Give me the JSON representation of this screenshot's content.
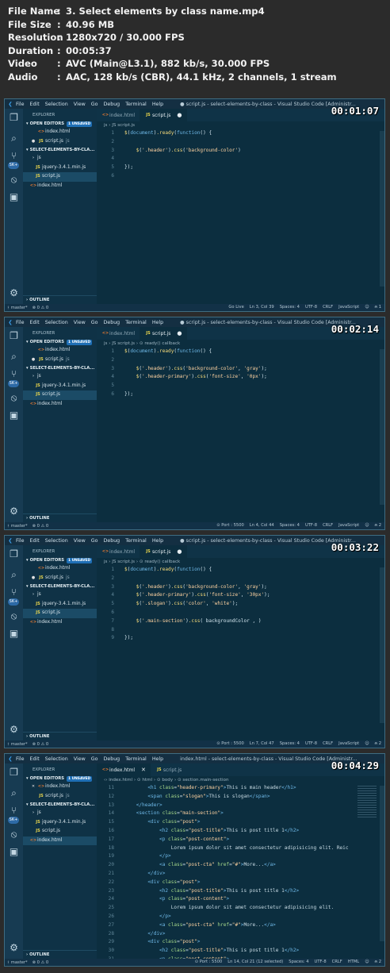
{
  "meta": {
    "rows": [
      {
        "key": "File Name",
        "value": "3. Select elements by class name.mp4"
      },
      {
        "key": "File Size",
        "value": "40.96 MB"
      },
      {
        "key": "Resolution",
        "value": "1280x720 / 30.000 FPS"
      },
      {
        "key": "Duration",
        "value": "00:05:37"
      },
      {
        "key": "Video",
        "value": "AVC (Main@L3.1), 882 kb/s, 30.000 FPS"
      },
      {
        "key": "Audio",
        "value": "AAC, 128 kb/s (CBR), 44.1 kHz, 2 channels, 1 stream"
      }
    ]
  },
  "menu": [
    "File",
    "Edit",
    "Selection",
    "View",
    "Go",
    "Debug",
    "Terminal",
    "Help"
  ],
  "explorer": {
    "title": "EXPLORER",
    "open_editors": "OPEN EDITORS",
    "unsaved": "1 UNSAVED",
    "folder": "SELECT-ELEMENTS-BY-CLA...",
    "outline": "OUTLINE",
    "files": {
      "js_folder": "js",
      "jquery": "jquery-3.4.1.min.js",
      "script": "script.js",
      "index": "index.html"
    }
  },
  "frames": [
    {
      "timestamp": "00:01:07",
      "window_title": "● script.js - select-elements-by-class - Visual Studio Code [Administr...",
      "open_files": [
        {
          "icon": "html",
          "name": "index.html",
          "extra": ""
        },
        {
          "icon": "js",
          "name": "script.js",
          "extra": "js",
          "dot": true
        }
      ],
      "tabs": [
        {
          "label": "index.html",
          "active": false,
          "icon": "html",
          "mark": ""
        },
        {
          "label": "script.js",
          "active": true,
          "icon": "js",
          "mark": "●"
        }
      ],
      "crumbs": "js › JS script.js",
      "code": [
        {
          "n": "1",
          "t": "$(document).ready(function() {"
        },
        {
          "n": "2",
          "t": ""
        },
        {
          "n": "3",
          "t": "    $('.header').css('background-color')"
        },
        {
          "n": "4",
          "t": ""
        },
        {
          "n": "5",
          "t": "});"
        },
        {
          "n": "6",
          "t": ""
        }
      ],
      "status_left": [
        "ᚼ master*",
        "⊗ 0 ⚠ 0"
      ],
      "status_right": [
        "Go Live",
        "Ln 3, Col 39",
        "Spaces: 4",
        "UTF-8",
        "CRLF",
        "JavaScript",
        "☺",
        "⍾ 1"
      ]
    },
    {
      "timestamp": "00:02:14",
      "window_title": "● script.js - select-elements-by-class - Visual Studio Code [Administr...",
      "open_files": [
        {
          "icon": "html",
          "name": "index.html",
          "extra": ""
        },
        {
          "icon": "js",
          "name": "script.js",
          "extra": "js",
          "dot": true
        }
      ],
      "tabs": [
        {
          "label": "index.html",
          "active": false,
          "icon": "html",
          "mark": ""
        },
        {
          "label": "script.js",
          "active": true,
          "icon": "js",
          "mark": "●"
        }
      ],
      "crumbs": "js › JS script.js › ⊙ ready() callback",
      "code": [
        {
          "n": "1",
          "t": "$(document).ready(function() {"
        },
        {
          "n": "2",
          "t": ""
        },
        {
          "n": "3",
          "t": "    $('.header').css('background-color', 'gray');"
        },
        {
          "n": "4",
          "t": "    $('.header-primary').css('font-size', '0px');"
        },
        {
          "n": "5",
          "t": ""
        },
        {
          "n": "6",
          "t": "});"
        }
      ],
      "status_left": [
        "ᚼ master*",
        "⊗ 0 ⚠ 0"
      ],
      "status_right": [
        "⊙ Port : 5500",
        "Ln 4, Col 44",
        "Spaces: 4",
        "UTF-8",
        "CRLF",
        "JavaScript",
        "☺",
        "⍾ 2"
      ]
    },
    {
      "timestamp": "00:03:22",
      "window_title": "● script.js - select-elements-by-class - Visual Studio Code [Administr...",
      "open_files": [
        {
          "icon": "html",
          "name": "index.html",
          "extra": ""
        },
        {
          "icon": "js",
          "name": "script.js",
          "extra": "js",
          "dot": true
        }
      ],
      "tabs": [
        {
          "label": "index.html",
          "active": false,
          "icon": "html",
          "mark": ""
        },
        {
          "label": "script.js",
          "active": true,
          "icon": "js",
          "mark": "●"
        }
      ],
      "crumbs": "js › JS script.js › ⊙ ready() callback",
      "code": [
        {
          "n": "1",
          "t": "$(document).ready(function() {"
        },
        {
          "n": "2",
          "t": ""
        },
        {
          "n": "3",
          "t": "    $('.header').css('background-color', 'gray');"
        },
        {
          "n": "4",
          "t": "    $('.header-primary').css('font-size', '30px');"
        },
        {
          "n": "5",
          "t": "    $('.slogan').css('color', 'white');"
        },
        {
          "n": "6",
          "t": ""
        },
        {
          "n": "7",
          "t": "    $('.main-section').css( backgroundColor , )"
        },
        {
          "n": "8",
          "t": ""
        },
        {
          "n": "9",
          "t": "});"
        }
      ],
      "status_left": [
        "ᚼ master*",
        "⊗ 0 ⚠ 0"
      ],
      "status_right": [
        "⊙ Port : 5500",
        "Ln 7, Col 47",
        "Spaces: 4",
        "UTF-8",
        "CRLF",
        "JavaScript",
        "☺",
        "⍾ 2"
      ]
    },
    {
      "timestamp": "00:04:29",
      "window_title": "index.html - select-elements-by-class - Visual Studio Code [Administr...",
      "open_files": [
        {
          "icon": "x",
          "name": "index.html",
          "extra": ""
        },
        {
          "icon": "js",
          "name": "script.js",
          "extra": "js"
        }
      ],
      "tabs": [
        {
          "label": "index.html",
          "active": true,
          "icon": "html",
          "mark": "✕"
        },
        {
          "label": "script.js",
          "active": false,
          "icon": "js",
          "mark": ""
        }
      ],
      "crumbs": "‹› index.html › ⊙ html › ⊙ body › ⊙ section.main-section",
      "html_mode": true,
      "code": [
        {
          "n": "11",
          "t": "        <h1 class=\"header-primary\">This is main header</h1>"
        },
        {
          "n": "12",
          "t": "        <span class=\"slogan\">This is slogan</span>"
        },
        {
          "n": "13",
          "t": "    </header>"
        },
        {
          "n": "14",
          "t": "    <section class=\"main-section\">"
        },
        {
          "n": "15",
          "t": "        <div class=\"post\">"
        },
        {
          "n": "16",
          "t": "            <h2 class=\"post-title\">This is post title 1</h2>"
        },
        {
          "n": "17",
          "t": "            <p class=\"post-content\">"
        },
        {
          "n": "18",
          "t": "                Lorem ipsum dolor sit amet consectetur adipisicing elit. Reic"
        },
        {
          "n": "19",
          "t": "            </p>"
        },
        {
          "n": "20",
          "t": "            <a class=\"post-cta\" href=\"#\">More...</a>"
        },
        {
          "n": "21",
          "t": "        </div>"
        },
        {
          "n": "22",
          "t": "        <div class=\"post\">"
        },
        {
          "n": "23",
          "t": "            <h2 class=\"post-title\">This is post title 1</h2>"
        },
        {
          "n": "24",
          "t": "            <p class=\"post-content\">"
        },
        {
          "n": "25",
          "t": "                Lorem ipsum dolor sit amet consectetur adipisicing elit."
        },
        {
          "n": "26",
          "t": "            </p>"
        },
        {
          "n": "27",
          "t": "            <a class=\"post-cta\" href=\"#\">More...</a>"
        },
        {
          "n": "28",
          "t": "        </div>"
        },
        {
          "n": "29",
          "t": "        <div class=\"post\">"
        },
        {
          "n": "30",
          "t": "            <h2 class=\"post-title\">This is post title 1</h2>"
        },
        {
          "n": "31",
          "t": "            <p class=\"post-content\">"
        }
      ],
      "status_left": [
        "ᚼ master*",
        "⊗ 0 ⚠ 0"
      ],
      "status_right": [
        "⊙ Port : 5500",
        "Ln 14, Col 21 (12 selected)",
        "Spaces: 4",
        "UTF-8",
        "CRLF",
        "HTML",
        "☺",
        "⍾ 2"
      ]
    }
  ],
  "colors": {
    "frame_bg": "#0c2e3f",
    "activity": "#173b52",
    "sidebar": "#0f3246",
    "status": "#123147",
    "badge": "#1f6fb5"
  }
}
